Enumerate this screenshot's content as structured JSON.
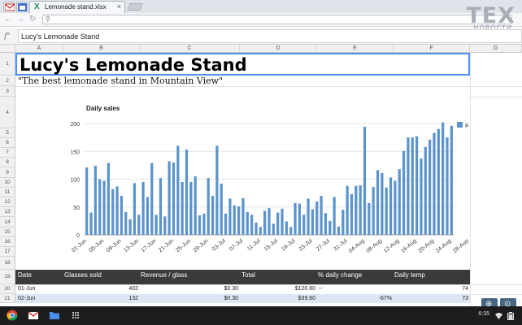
{
  "browser": {
    "tab_title": "Lemonade stand.xlsx",
    "tab_close": "×"
  },
  "watermark": {
    "big": "TEX",
    "small": "НОВОСТИ"
  },
  "formula_bar": {
    "fx": "fx",
    "value": "Lucy's Lemonade Stand"
  },
  "columns": [
    "A",
    "B",
    "C",
    "D",
    "E",
    "F",
    "G"
  ],
  "rows": [
    "1",
    "2",
    "3",
    "4",
    "5",
    "6",
    "7",
    "8",
    "9",
    "10",
    "11",
    "12",
    "13",
    "14",
    "15",
    "16",
    "17",
    "18",
    "19",
    "20",
    "21"
  ],
  "sheet": {
    "title": "Lucy's Lemonade Stand",
    "subtitle": "\"The best lemonade stand in Mountain View\""
  },
  "chart_data": {
    "type": "bar",
    "title": "Daily sales",
    "legend": "Revenue",
    "legend_position": "right",
    "ylim": [
      0,
      200
    ],
    "yticks": [
      "0",
      "50",
      "100",
      "150",
      "200"
    ],
    "xtick_labels": [
      "01-Jun",
      "05-Jun",
      "09-Jun",
      "13-Jun",
      "17-Jun",
      "21-Jun",
      "25-Jun",
      "29-Jun",
      "03-Jul",
      "07-Jul",
      "11-Jul",
      "15-Jul",
      "19-Jul",
      "23-Jul",
      "27-Jul",
      "31-Jul",
      "04-Aug",
      "08-Aug",
      "12-Aug",
      "16-Aug",
      "20-Aug",
      "24-Aug",
      "28-Aug"
    ],
    "values": [
      121,
      40,
      124,
      100,
      97,
      129,
      82,
      87,
      70,
      41,
      28,
      93,
      36,
      95,
      68,
      129,
      36,
      102,
      33,
      132,
      130,
      160,
      95,
      153,
      95,
      105,
      35,
      38,
      102,
      70,
      160,
      92,
      38,
      65,
      53,
      51,
      66,
      41,
      36,
      22,
      14,
      43,
      48,
      20,
      40,
      47,
      24,
      14,
      57,
      56,
      36,
      65,
      46,
      60,
      70,
      39,
      25,
      68,
      15,
      45,
      88,
      73,
      88,
      89,
      194,
      57,
      86,
      116,
      111,
      85,
      103,
      97,
      118,
      151,
      175,
      175,
      177,
      137,
      158,
      171,
      183,
      190,
      202,
      175,
      196
    ],
    "color": "#5b93cb"
  },
  "table": {
    "headers": [
      "Date",
      "Glasses sold",
      "Revenue / glass",
      "Total",
      "% daily change",
      "Daily temp"
    ],
    "rows": [
      [
        "01-Jun",
        "402",
        "$0.30",
        "$120.60",
        "--",
        "74"
      ],
      [
        "02-Jun",
        "132",
        "$0.30",
        "$39.60",
        "-67%",
        "73"
      ]
    ]
  },
  "shelf": {
    "time": "6:35"
  }
}
